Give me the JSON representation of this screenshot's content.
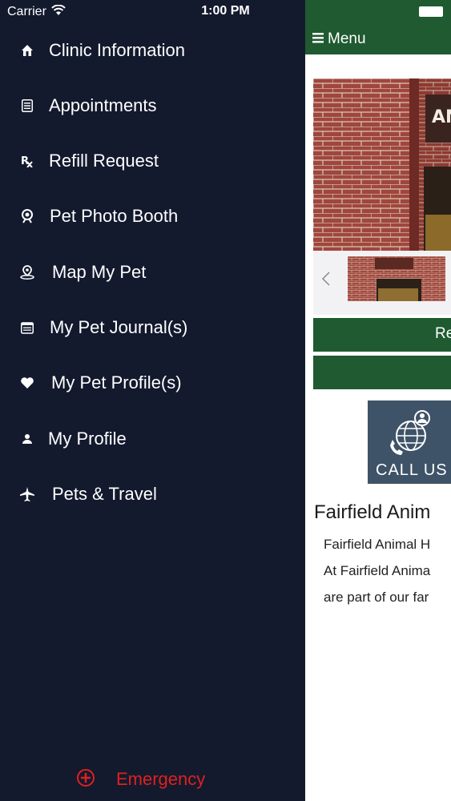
{
  "status_bar": {
    "carrier": "Carrier",
    "time": "1:00 PM",
    "wifi_icon": "wifi-icon",
    "battery_icon": "battery-icon"
  },
  "sidebar": {
    "background": "#131a2e",
    "items": [
      {
        "label": "Clinic Information",
        "icon": "house-icon"
      },
      {
        "label": "Appointments",
        "icon": "list-icon"
      },
      {
        "label": "Refill Request",
        "icon": "rx-icon"
      },
      {
        "label": "Pet Photo Booth",
        "icon": "camera-icon"
      },
      {
        "label": "Map My Pet",
        "icon": "map-pin-icon"
      },
      {
        "label": "My Pet Journal(s)",
        "icon": "journal-icon"
      },
      {
        "label": "My Pet Profile(s)",
        "icon": "heart-icon"
      },
      {
        "label": "My Profile",
        "icon": "person-icon"
      },
      {
        "label": "Pets & Travel",
        "icon": "airplane-icon"
      }
    ],
    "emergency": {
      "label": "Emergency",
      "icon": "plus-circle-icon",
      "color": "#e0201f"
    }
  },
  "main": {
    "topbar_color": "#1f5a30",
    "menu_label": "Menu",
    "menu_icon": "hamburger-icon",
    "gallery": {
      "prev_icon": "chevron-left-icon"
    },
    "buttons": [
      {
        "label": "Re"
      },
      {
        "label": ""
      }
    ],
    "call_us_label": "CALL US",
    "heading": "Fairfield Anim",
    "paragraph_lines": [
      "Fairfield Animal H",
      "At Fairfield Anima",
      "are part of our far"
    ]
  }
}
